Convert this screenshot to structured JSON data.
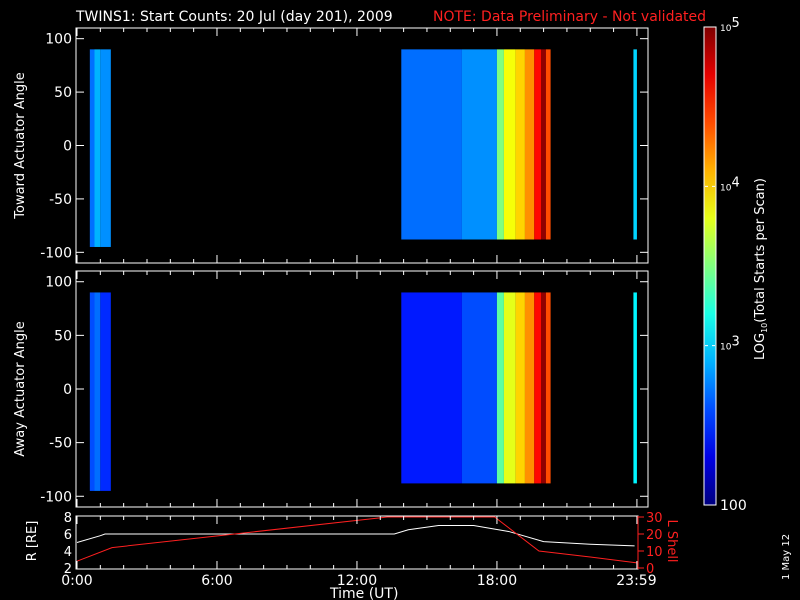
{
  "chart_data": {
    "type": "heatmap",
    "title": "TWINS1: Start Counts: 20 Jul (day 201), 2009",
    "note": "NOTE: Data Preliminary - Not validated",
    "date_stamp": "1 May 12",
    "colorbar": {
      "label": "LOG10(Total Starts per Scan)",
      "ticks": [
        "100",
        "10",
        "3",
        "10",
        "4",
        "10",
        "5"
      ],
      "tick_labels": [
        {
          "base": "100",
          "exp": ""
        },
        {
          "base": "10",
          "exp": "3"
        },
        {
          "base": "10",
          "exp": "4"
        },
        {
          "base": "10",
          "exp": "5"
        }
      ],
      "range_log": [
        2,
        5
      ]
    },
    "panels": [
      {
        "ylabel": "Toward Actuator Angle",
        "yticks": [
          "100",
          "50",
          "0",
          "-50",
          "-100"
        ],
        "ylim": [
          -110,
          110
        ],
        "columns": [
          [
            0.55,
            0.75,
            2.7
          ],
          [
            0.75,
            1.0,
            2.9
          ],
          [
            1.0,
            1.45,
            2.8
          ],
          [
            13.9,
            16.5,
            2.7
          ],
          [
            16.5,
            18.0,
            2.8
          ],
          [
            18.0,
            18.3,
            3.5
          ],
          [
            18.3,
            18.8,
            3.85
          ],
          [
            18.8,
            19.2,
            4.0
          ],
          [
            19.2,
            19.6,
            4.2
          ],
          [
            19.6,
            19.9,
            4.6
          ],
          [
            19.9,
            20.1,
            4.95
          ],
          [
            20.1,
            20.3,
            4.4
          ],
          [
            23.85,
            24.0,
            3.0
          ]
        ]
      },
      {
        "ylabel": "Away Actuator Angle",
        "yticks": [
          "100",
          "50",
          "0",
          "-50",
          "-100"
        ],
        "ylim": [
          -110,
          110
        ],
        "columns": [
          [
            0.55,
            0.75,
            2.6
          ],
          [
            0.75,
            1.0,
            2.7
          ],
          [
            1.0,
            1.45,
            2.5
          ],
          [
            13.9,
            16.5,
            2.45
          ],
          [
            16.5,
            18.0,
            2.6
          ],
          [
            18.0,
            18.3,
            3.4
          ],
          [
            18.3,
            18.8,
            3.8
          ],
          [
            18.8,
            19.2,
            4.0
          ],
          [
            19.2,
            19.6,
            4.2
          ],
          [
            19.6,
            19.9,
            4.6
          ],
          [
            19.9,
            20.1,
            4.95
          ],
          [
            20.1,
            20.3,
            4.4
          ],
          [
            23.85,
            24.0,
            3.1
          ]
        ]
      }
    ],
    "orbit": {
      "ylabel_left": "R [RE]",
      "yticks_left": [
        "8",
        "6",
        "4",
        "2"
      ],
      "ylim_left": [
        2,
        8
      ],
      "ylabel_right": "L Shell",
      "yticks_right": [
        "30",
        "20",
        "10",
        "0"
      ],
      "ylim_right": [
        0,
        30
      ],
      "R": {
        "t": [
          0,
          1,
          1.2,
          13.6,
          14.2,
          15.5,
          17,
          18.5,
          20,
          22,
          23.9
        ],
        "v": [
          5,
          5.8,
          6,
          6,
          6.5,
          7,
          7,
          6.3,
          5.1,
          4.8,
          4.6
        ]
      },
      "L": {
        "t": [
          0,
          1.5,
          13.3,
          17.9,
          19.8,
          22,
          24
        ],
        "v": [
          4,
          12,
          30,
          30,
          10,
          6.5,
          3
        ]
      }
    },
    "xticks": [
      "0:00",
      "6:00",
      "12:00",
      "18:00",
      "23:59"
    ],
    "xlabel": "Time (UT)",
    "colors": {
      "note": "#ff2020",
      "L": "#ff2020",
      "R": "#ffffff"
    }
  }
}
